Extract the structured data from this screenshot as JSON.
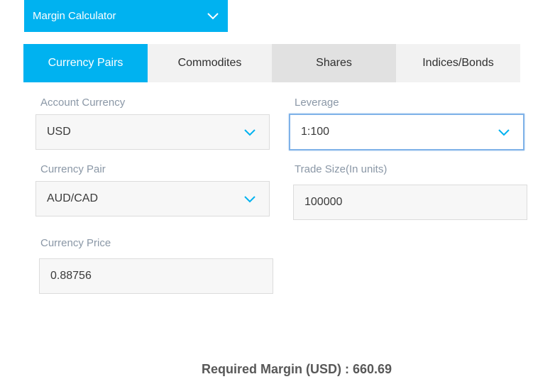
{
  "header": {
    "calculator_select": "Margin Calculator"
  },
  "tabs": [
    {
      "label": "Currency Pairs",
      "active": true
    },
    {
      "label": "Commodites",
      "active": false
    },
    {
      "label": "Shares",
      "active": false
    },
    {
      "label": "Indices/Bonds",
      "active": false
    }
  ],
  "form": {
    "account_currency": {
      "label": "Account Currency",
      "value": "USD"
    },
    "leverage": {
      "label": "Leverage",
      "value": "1:100"
    },
    "currency_pair": {
      "label": "Currency Pair",
      "value": "AUD/CAD"
    },
    "trade_size": {
      "label": "Trade Size(In units)",
      "value": "100000"
    },
    "currency_price": {
      "label": "Currency Price",
      "value": "0.88756"
    }
  },
  "result": {
    "label": "Required Margin (USD) : ",
    "value": "660.69"
  },
  "colors": {
    "accent": "#00b2f0",
    "label": "#8a97a6",
    "focus_border": "#7fb2e8"
  },
  "icons": {
    "dropdown": "chevron-down-icon"
  }
}
